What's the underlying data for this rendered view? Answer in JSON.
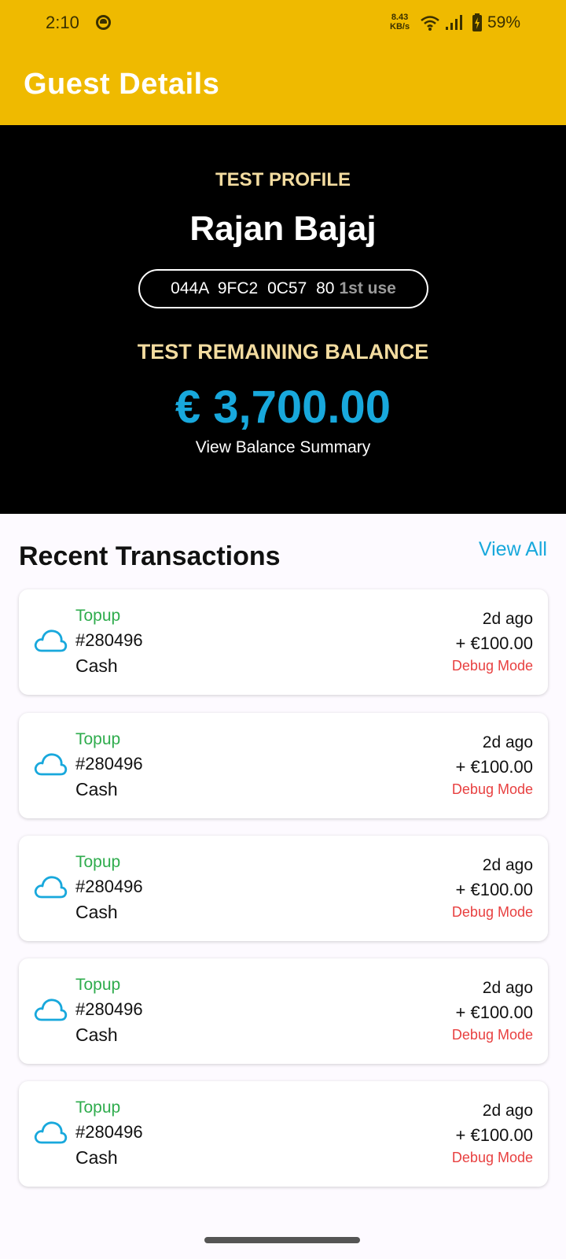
{
  "status_bar": {
    "time": "2:10",
    "net_speed_value": "8.43",
    "net_speed_unit": "KB/s",
    "battery_percent": "59%"
  },
  "app_bar": {
    "title": "Guest Details"
  },
  "profile": {
    "label": "TEST PROFILE",
    "name": "Rajan Bajaj",
    "uid": "044A 9FC2 0C57 80",
    "uid_use": "1st use",
    "balance_label": "TEST REMAINING BALANCE",
    "balance": "€ 3,700.00",
    "balance_link": "View Balance Summary"
  },
  "transactions_section": {
    "title": "Recent Transactions",
    "view_all": "View All"
  },
  "transactions": [
    {
      "type": "Topup",
      "id": "#280496",
      "method": "Cash",
      "time": "2d ago",
      "amount": "+ €100.00",
      "mode": "Debug Mode"
    },
    {
      "type": "Topup",
      "id": "#280496",
      "method": "Cash",
      "time": "2d ago",
      "amount": "+ €100.00",
      "mode": "Debug Mode"
    },
    {
      "type": "Topup",
      "id": "#280496",
      "method": "Cash",
      "time": "2d ago",
      "amount": "+ €100.00",
      "mode": "Debug Mode"
    },
    {
      "type": "Topup",
      "id": "#280496",
      "method": "Cash",
      "time": "2d ago",
      "amount": "+ €100.00",
      "mode": "Debug Mode"
    },
    {
      "type": "Topup",
      "id": "#280496",
      "method": "Cash",
      "time": "2d ago",
      "amount": "+ €100.00",
      "mode": "Debug Mode"
    }
  ],
  "icons": {
    "transaction": "cloud-icon",
    "status": [
      "camera-dot-icon",
      "wifi-icon",
      "signal-icon",
      "battery-charging-icon"
    ]
  },
  "colors": {
    "app_bar": "#efba00",
    "accent": "#18a8dc",
    "topup": "#2fac4d",
    "debug": "#e84040",
    "hero_label": "#f3dca0"
  }
}
